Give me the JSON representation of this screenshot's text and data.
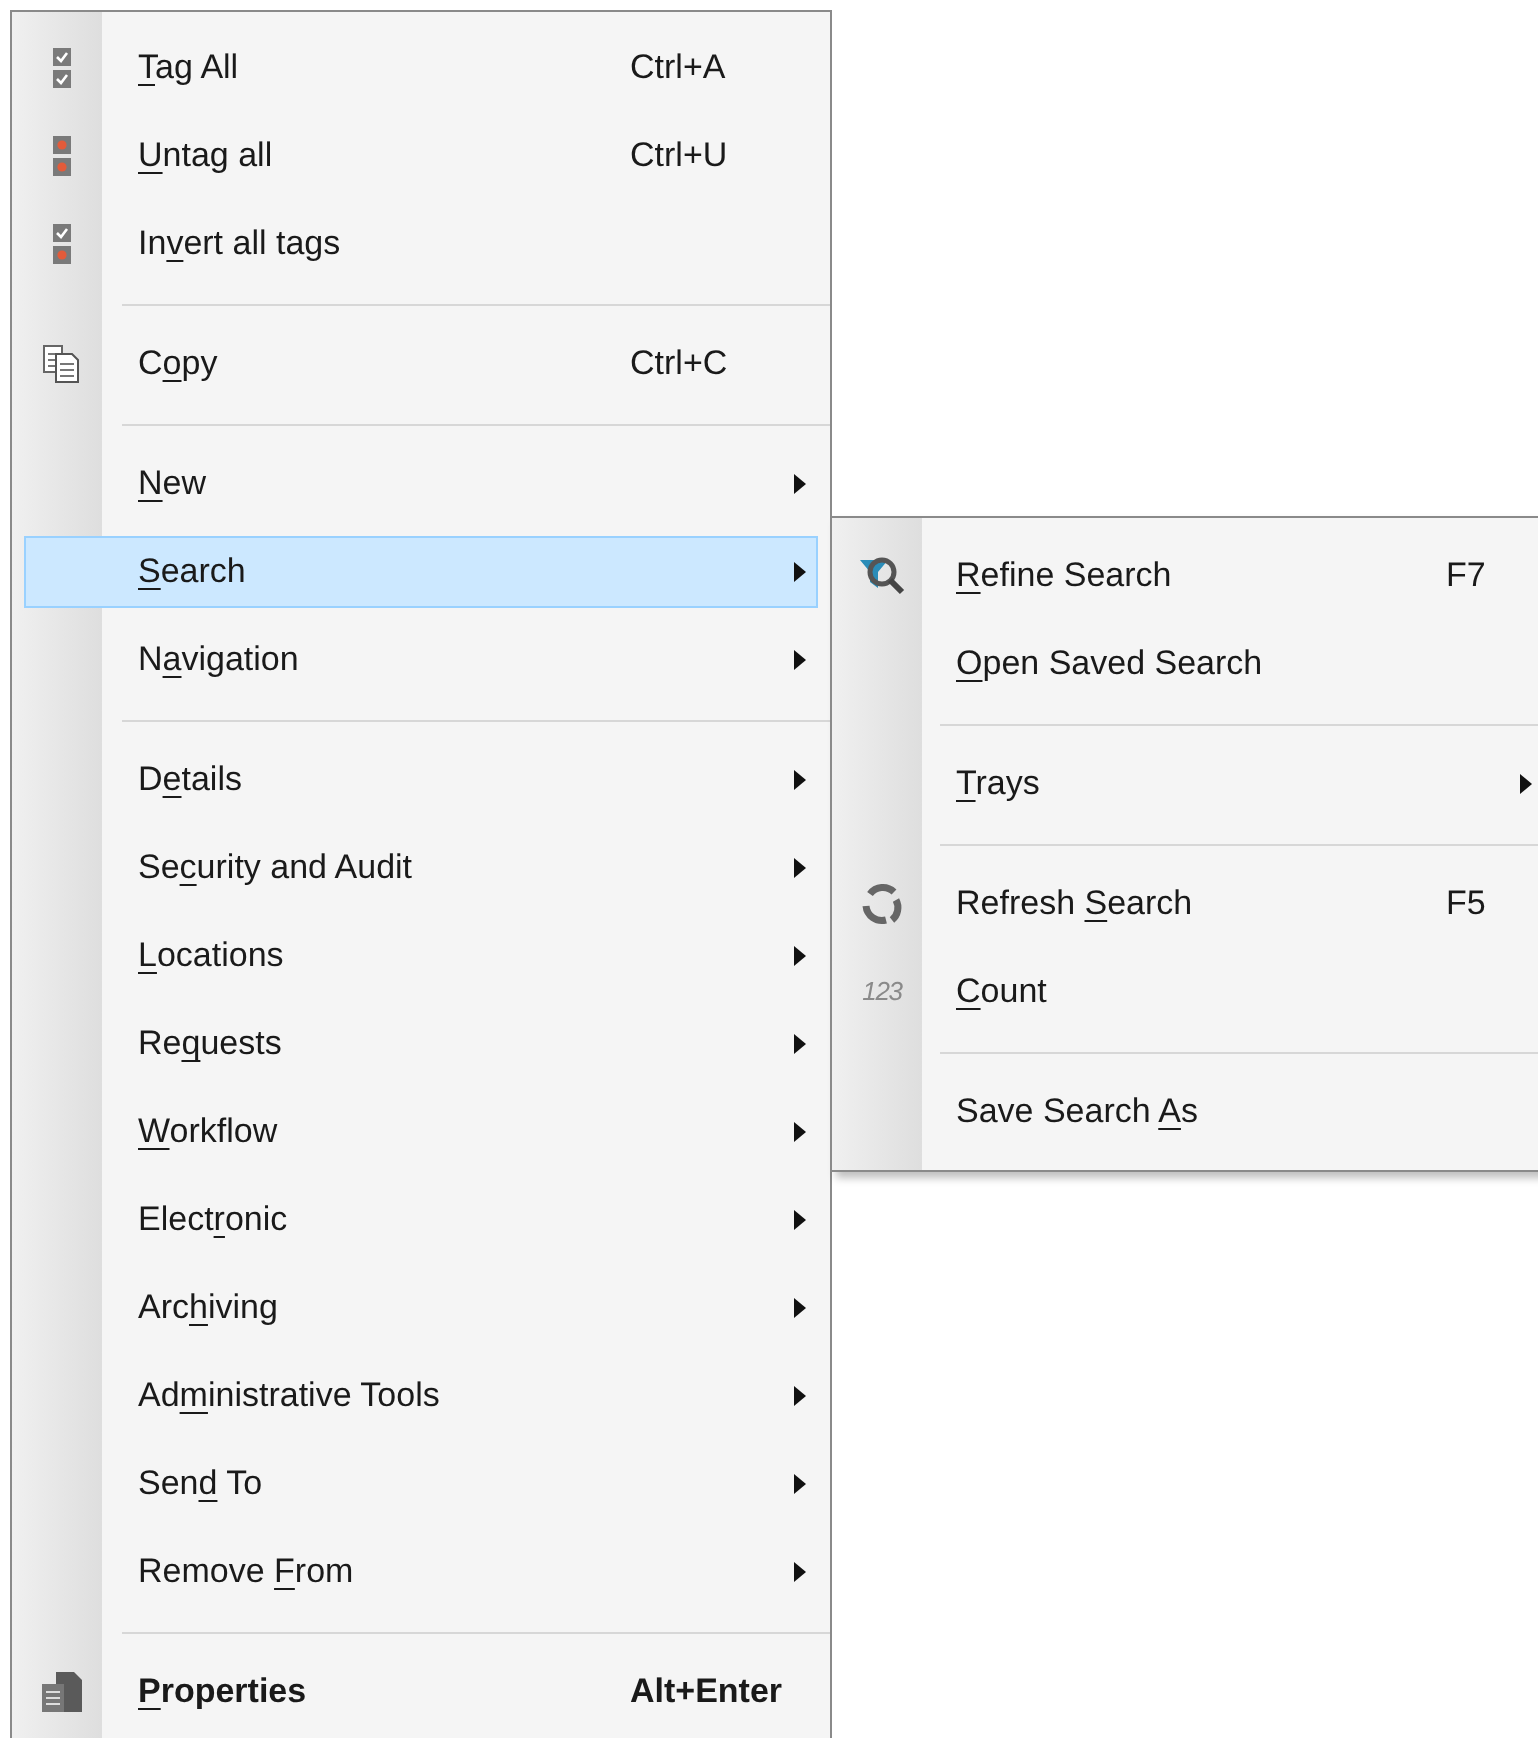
{
  "context_menu": {
    "items": [
      {
        "kind": "tag-all",
        "key": "T",
        "after": "ag All",
        "shortcut": "Ctrl+A",
        "submenu": false,
        "selected": false,
        "default": false
      },
      {
        "kind": "untag-all",
        "key": "U",
        "after": "ntag all",
        "shortcut": "Ctrl+U",
        "submenu": false,
        "selected": false,
        "default": false
      },
      {
        "kind": "invert-tags",
        "before": "In",
        "key": "v",
        "after": "ert all tags",
        "submenu": false,
        "selected": false,
        "default": false
      },
      {
        "kind": "separator"
      },
      {
        "kind": "copy",
        "before": "C",
        "key": "o",
        "after": "py",
        "shortcut": "Ctrl+C",
        "submenu": false,
        "selected": false,
        "default": false
      },
      {
        "kind": "separator"
      },
      {
        "kind": "plain",
        "key": "N",
        "after": "ew",
        "submenu": true,
        "selected": false,
        "default": false
      },
      {
        "kind": "plain",
        "key": "S",
        "after": "earch",
        "submenu": true,
        "selected": true,
        "default": false
      },
      {
        "kind": "plain",
        "before": "N",
        "key": "a",
        "after": "vigation",
        "submenu": true,
        "selected": false,
        "default": false
      },
      {
        "kind": "separator"
      },
      {
        "kind": "plain",
        "before": "D",
        "key": "e",
        "after": "tails",
        "submenu": true,
        "selected": false,
        "default": false
      },
      {
        "kind": "plain",
        "before": "Se",
        "key": "c",
        "after": "urity and Audit",
        "submenu": true,
        "selected": false,
        "default": false
      },
      {
        "kind": "plain",
        "key": "L",
        "after": "ocations",
        "submenu": true,
        "selected": false,
        "default": false
      },
      {
        "kind": "plain",
        "before": "Re",
        "key": "q",
        "after": "uests",
        "submenu": true,
        "selected": false,
        "default": false
      },
      {
        "kind": "plain",
        "key": "W",
        "after": "orkflow",
        "submenu": true,
        "selected": false,
        "default": false
      },
      {
        "kind": "plain",
        "before": "Elect",
        "key": "r",
        "after": "onic",
        "submenu": true,
        "selected": false,
        "default": false
      },
      {
        "kind": "plain",
        "before": "Arc",
        "key": "h",
        "after": "iving",
        "submenu": true,
        "selected": false,
        "default": false
      },
      {
        "kind": "plain",
        "before": "Ad",
        "key": "m",
        "after": "inistrative Tools",
        "submenu": true,
        "selected": false,
        "default": false
      },
      {
        "kind": "plain",
        "before": "Sen",
        "key": "d",
        "after": " To",
        "submenu": true,
        "selected": false,
        "default": false
      },
      {
        "kind": "plain",
        "before": "Remove ",
        "key": "F",
        "after": "rom",
        "submenu": true,
        "selected": false,
        "default": false
      },
      {
        "kind": "separator"
      },
      {
        "kind": "properties",
        "key": "P",
        "after": "roperties",
        "shortcut": "Alt+Enter",
        "submenu": false,
        "selected": false,
        "default": true
      }
    ]
  },
  "search_submenu": {
    "items": [
      {
        "kind": "filter-search",
        "key": "R",
        "after": "efine Search",
        "shortcut": "F7",
        "submenu": false,
        "selected": false
      },
      {
        "kind": "plain",
        "key": "O",
        "after": "pen Saved Search",
        "submenu": false,
        "selected": false
      },
      {
        "kind": "separator"
      },
      {
        "kind": "plain",
        "key": "T",
        "after": "rays",
        "submenu": true,
        "selected": false
      },
      {
        "kind": "separator"
      },
      {
        "kind": "refresh",
        "before": "Refresh ",
        "key": "S",
        "after": "earch",
        "shortcut": "F5",
        "submenu": false,
        "selected": false
      },
      {
        "kind": "counter",
        "icon_text": "123",
        "key": "C",
        "after": "ount",
        "submenu": false,
        "selected": false
      },
      {
        "kind": "separator"
      },
      {
        "kind": "plain",
        "before": "Save Search ",
        "key": "A",
        "after": "s",
        "submenu": false,
        "selected": false
      }
    ]
  }
}
